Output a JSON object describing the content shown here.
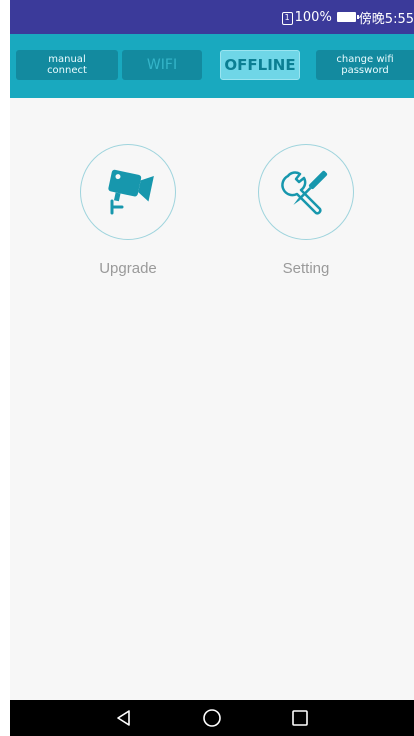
{
  "status_bar": {
    "sim_glyph": "1",
    "battery_text": "100%",
    "time_text": "傍晚5:55"
  },
  "toolbar": {
    "manual_connect_label": "manual\nconnect",
    "wifi_label": "WIFI",
    "offline_label": "OFFLINE",
    "change_wifi_label": "change wifi\npassword"
  },
  "tiles": {
    "upgrade_label": "Upgrade",
    "setting_label": "Setting"
  },
  "icons": {
    "upgrade": "camera-icon",
    "setting": "tools-icon",
    "back": "back-triangle-icon",
    "home": "home-circle-icon",
    "recents": "recents-square-icon"
  },
  "colors": {
    "status_bar": "#3b3a9a",
    "toolbar": "#19a9bf",
    "button_dark": "#138a9f",
    "button_active": "#6fd6e7",
    "icon_teal": "#1797ad",
    "circle_border": "#9fd4dd",
    "label_gray": "#9a9a9a",
    "nav_bar": "#000000"
  }
}
